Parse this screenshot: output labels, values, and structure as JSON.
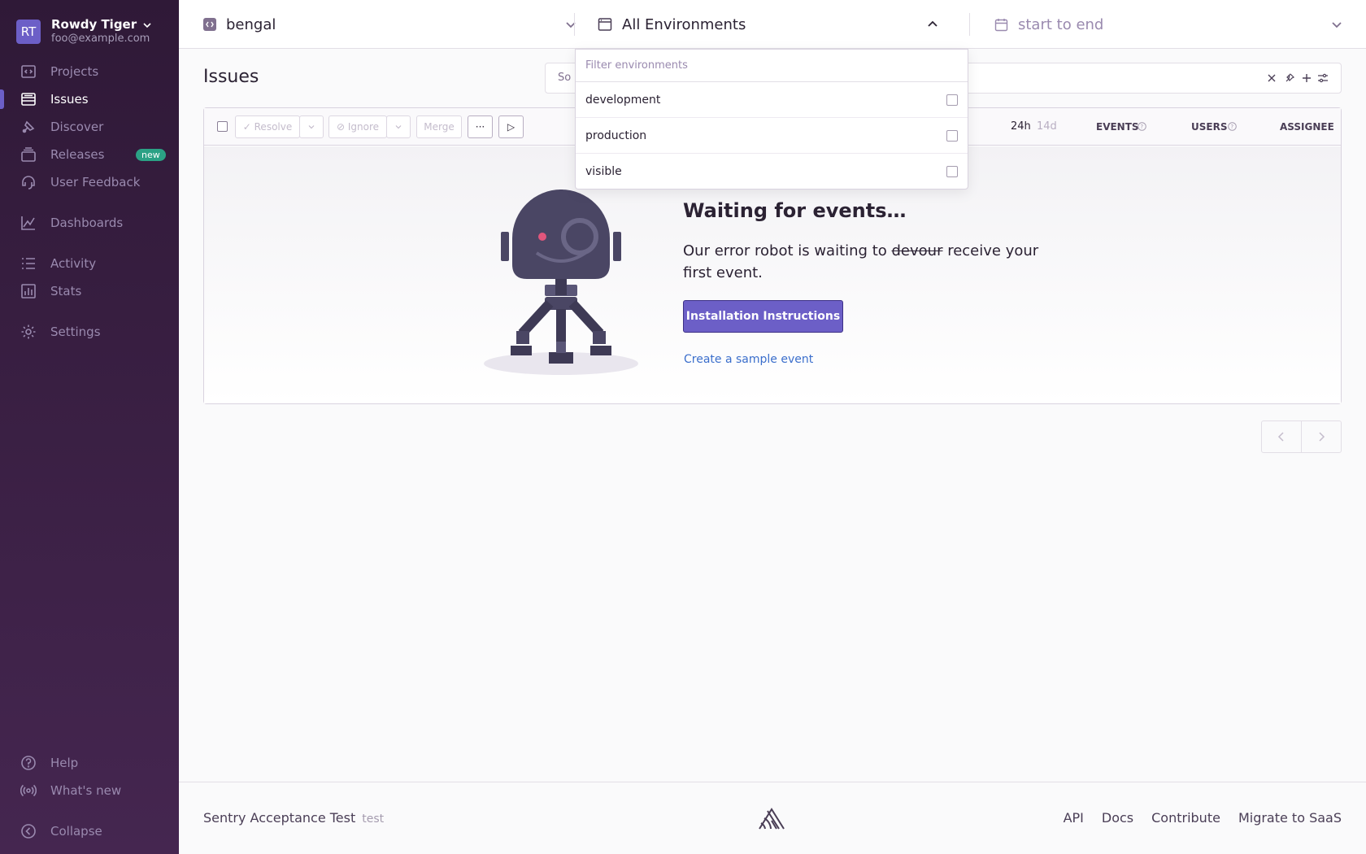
{
  "org": {
    "avatar": "RT",
    "name": "Rowdy Tiger",
    "email": "foo@example.com"
  },
  "sidebar": {
    "items": [
      {
        "label": "Projects",
        "icon": "projects-icon"
      },
      {
        "label": "Issues",
        "icon": "issues-icon",
        "active": true
      },
      {
        "label": "Discover",
        "icon": "discover-icon"
      },
      {
        "label": "Releases",
        "icon": "releases-icon",
        "badge": "new"
      },
      {
        "label": "User Feedback",
        "icon": "feedback-icon"
      },
      {
        "label": "Dashboards",
        "icon": "dashboards-icon"
      },
      {
        "label": "Activity",
        "icon": "activity-icon"
      },
      {
        "label": "Stats",
        "icon": "stats-icon"
      },
      {
        "label": "Settings",
        "icon": "settings-icon"
      }
    ],
    "bottom": [
      {
        "label": "Help",
        "icon": "help-icon"
      },
      {
        "label": "What's new",
        "icon": "broadcast-icon"
      },
      {
        "label": "Collapse",
        "icon": "collapse-icon"
      }
    ]
  },
  "header": {
    "project": "bengal",
    "environment": "All Environments",
    "date_range": "start to end"
  },
  "page": {
    "title": "Issues",
    "search_placeholder": "So"
  },
  "toolbar": {
    "resolve": "✓ Resolve",
    "ignore": "⊘ Ignore",
    "merge": "Merge",
    "more": "···",
    "play": "▷",
    "period_active": "24h",
    "period_inactive": "14d",
    "col_events": "EVENTS",
    "col_users": "USERS",
    "col_assignee": "ASSIGNEE"
  },
  "empty_state": {
    "title": "Waiting for events…",
    "text_before": "Our error robot is waiting to ",
    "text_strike": "devour",
    "text_after": " receive your first event.",
    "button": "Installation Instructions",
    "link": "Create a sample event"
  },
  "env_dropdown": {
    "placeholder": "Filter environments",
    "options": [
      "development",
      "production",
      "visible"
    ]
  },
  "footer": {
    "left": "Sentry Acceptance Test",
    "version": "test",
    "links": [
      "API",
      "Docs",
      "Contribute",
      "Migrate to SaaS"
    ]
  },
  "colors": {
    "accent": "#6c5fc7",
    "sidebar": "#2f1937",
    "link": "#3b6ecc",
    "badge": "#2ba185"
  }
}
